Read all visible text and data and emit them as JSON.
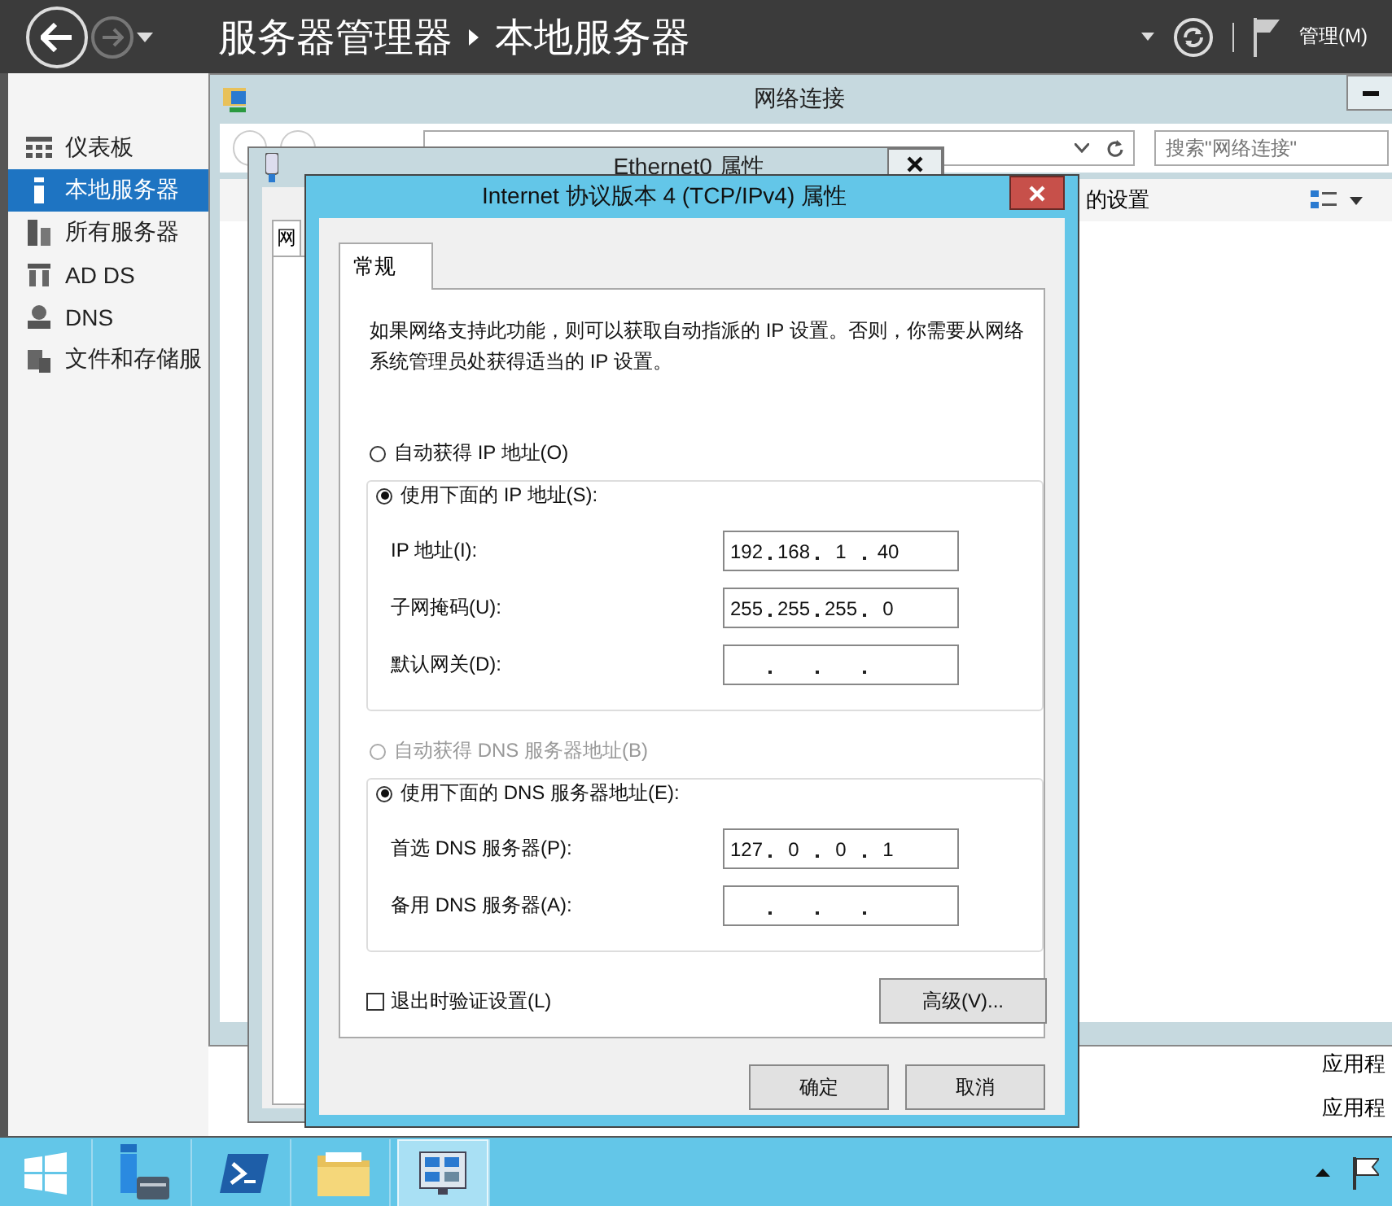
{
  "header": {
    "title": "服务器管理器",
    "page": "本地服务器",
    "menu": "管理(M)"
  },
  "sidebar": {
    "items": [
      {
        "label": "仪表板",
        "selected": false
      },
      {
        "label": "本地服务器",
        "selected": true
      },
      {
        "label": "所有服务器",
        "selected": false
      },
      {
        "label": "AD DS",
        "selected": false
      },
      {
        "label": "DNS",
        "selected": false
      },
      {
        "label": "文件和存储服",
        "selected": false
      }
    ]
  },
  "background_list": {
    "items": [
      "应用程",
      "应用程"
    ]
  },
  "network_window": {
    "title": "网络连接",
    "search": {
      "placeholder": "搜索\"网络连接\""
    },
    "toolbar_text": "的设置"
  },
  "ethernet_window": {
    "title": "Ethernet0 属性",
    "tab": "网"
  },
  "ipv4_dialog": {
    "title": "Internet 协议版本 4 (TCP/IPv4) 属性",
    "tabs": [
      {
        "label": "常规",
        "selected": true
      }
    ],
    "intro": "如果网络支持此功能，则可以获取自动指派的 IP 设置。否则，你需要从网络系统管理员处获得适当的 IP 设置。",
    "sections": [
      {
        "auto": {
          "label": "自动获得 IP 地址(O)",
          "selected": false,
          "disabled": false
        },
        "manual": {
          "label": "使用下面的 IP 地址(S):",
          "selected": true
        },
        "fields": [
          {
            "label": "IP 地址(I):",
            "octets": [
              "192",
              "168",
              "1",
              "40"
            ]
          },
          {
            "label": "子网掩码(U):",
            "octets": [
              "255",
              "255",
              "255",
              "0"
            ]
          },
          {
            "label": "默认网关(D):"
          }
        ]
      },
      {
        "auto": {
          "label": "自动获得 DNS 服务器地址(B)",
          "selected": false,
          "disabled": true
        },
        "manual": {
          "label": "使用下面的 DNS 服务器地址(E):",
          "selected": true
        },
        "fields": [
          {
            "label": "首选 DNS 服务器(P):",
            "octets": [
              "127",
              "0",
              "0",
              "1"
            ]
          },
          {
            "label": "备用 DNS 服务器(A):"
          }
        ]
      }
    ],
    "validate": {
      "label": "退出时验证设置(L)",
      "checked": false
    },
    "advanced": "高级(V)...",
    "buttons": [
      "确定",
      "取消"
    ]
  },
  "taskbar": {
    "apps": [
      {
        "kind": "start",
        "selected": false
      },
      {
        "kind": "server-manager",
        "selected": false
      },
      {
        "kind": "powershell",
        "selected": false
      },
      {
        "kind": "explorer",
        "selected": false
      },
      {
        "kind": "network",
        "selected": true
      }
    ]
  }
}
